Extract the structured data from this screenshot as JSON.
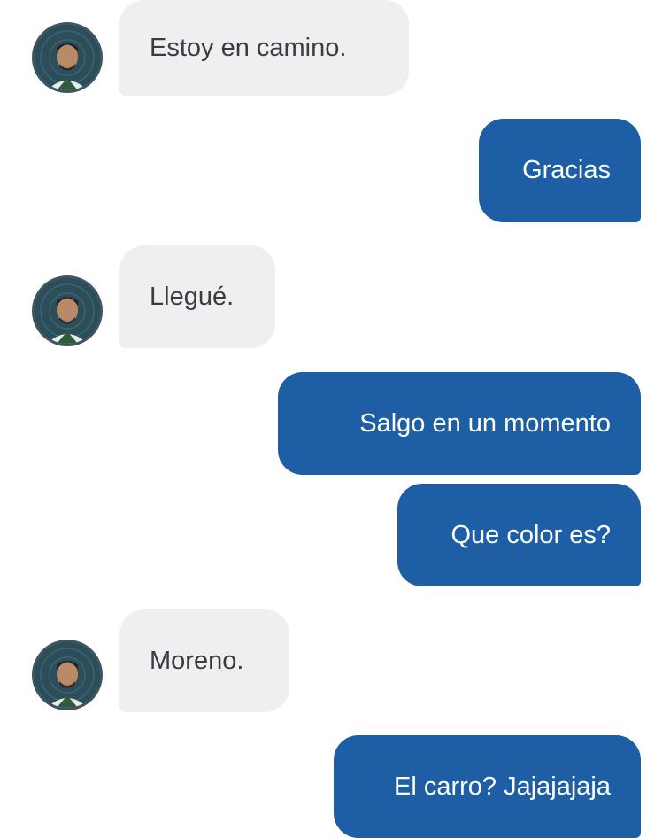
{
  "conversation": {
    "messages": [
      {
        "sender": "driver",
        "text": "Estoy en camino."
      },
      {
        "sender": "me",
        "text": "Gracias"
      },
      {
        "sender": "driver",
        "text": "Llegué."
      },
      {
        "sender": "me",
        "text": "Salgo en un momento"
      },
      {
        "sender": "me",
        "text": "Que color es?"
      },
      {
        "sender": "driver",
        "text": "Moreno."
      },
      {
        "sender": "me",
        "text": "El carro? Jajajajaja"
      }
    ]
  },
  "colors": {
    "incoming_bubble": "#efeff1",
    "incoming_text": "#3c3c40",
    "outgoing_bubble": "#1d5ea4",
    "outgoing_text": "#ffffff",
    "avatar_background": "#2c4e5a"
  },
  "icons": {
    "avatar": "driver-profile-photo"
  }
}
